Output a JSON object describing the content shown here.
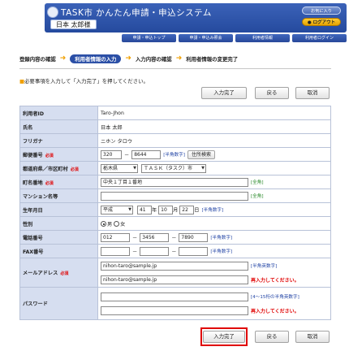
{
  "header": {
    "app_title": "TASK市 かんたん申請・申込システム",
    "user_name": "日本 太郎様",
    "favorites_label": "お気に入り",
    "logout_label": "● ログアウト",
    "nav": [
      "申請・申込トップ",
      "申請・申込み照会",
      "利用者情報",
      "利用者ログイン"
    ]
  },
  "steps": [
    "登録内容の確認",
    "利用者情報の入力",
    "入力内容の確認",
    "利用者情報の変更完了"
  ],
  "instruction": "必要事項を入力して「入力完了」を押してください。",
  "buttons": {
    "submit": "入力完了",
    "back": "戻る",
    "cancel": "取消"
  },
  "required_mark": "必須",
  "form": {
    "user_id": {
      "label": "利用者ID",
      "value": "Taro-Jhon"
    },
    "name": {
      "label": "氏名",
      "value": "日本 太郎"
    },
    "furigana": {
      "label": "フリガナ",
      "value": "ニホン タロウ"
    },
    "postal": {
      "label": "郵便番号",
      "value1": "320",
      "value2": "8644",
      "note": "[半角数字]",
      "search_button": "住所検索"
    },
    "prefecture": {
      "label": "都道府県／市区町村",
      "pref_value": "栃木県",
      "city_value": "ＴＡＳＫ（タスク）市"
    },
    "address": {
      "label": "町名番地",
      "value": "中央１丁目１番地",
      "note": "[全角]"
    },
    "building": {
      "label": "マンション名等",
      "value": "",
      "note": "[全角]"
    },
    "birth": {
      "label": "生年月日",
      "era": "平成",
      "year": "41",
      "month": "10",
      "day": "22",
      "year_unit": "年",
      "month_unit": "月",
      "day_unit": "日",
      "note": "[半角数字]"
    },
    "gender": {
      "label": "性別",
      "male": "男",
      "female": "女",
      "selected": "男"
    },
    "phone": {
      "label": "電話番号",
      "value1": "012",
      "value2": "3456",
      "value3": "7890",
      "note": "[半角数字]"
    },
    "fax": {
      "label": "FAX番号",
      "value1": "",
      "value2": "",
      "value3": "",
      "note": "[半角数字]"
    },
    "email": {
      "label": "メールアドレス",
      "value": "nihon-taro@sample.jp",
      "confirm_value": "nihon-taro@sample.jp",
      "note": "[半角英数字]",
      "reenter_note": "再入力してください。"
    },
    "password": {
      "label": "パスワード",
      "value": "",
      "confirm_value": "",
      "note": "[4～15桁の半角英数字]",
      "reenter_note": "再入力してください。"
    }
  }
}
